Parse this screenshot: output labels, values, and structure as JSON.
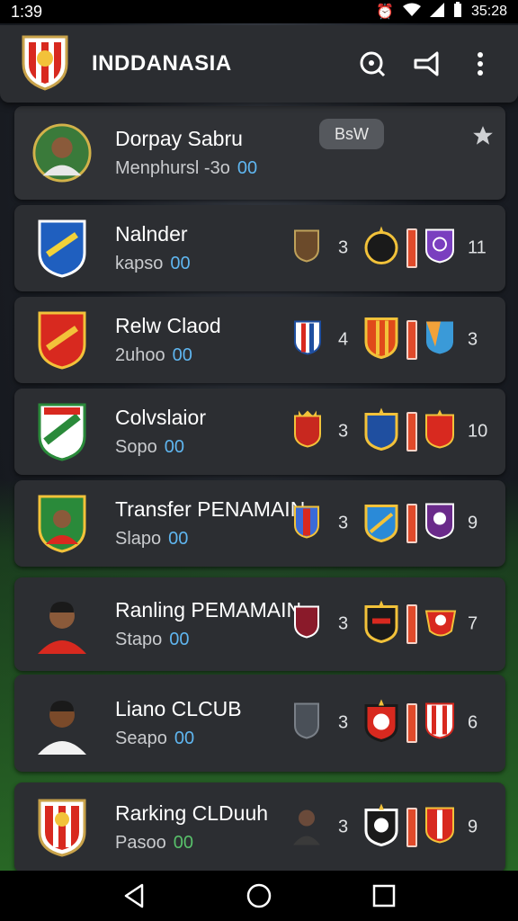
{
  "status_bar": {
    "time": "1:39",
    "clock_right": "35:28",
    "icons": [
      "alarm-icon",
      "wifi-icon",
      "signal-icon",
      "battery-icon"
    ]
  },
  "app_bar": {
    "title": "INDDANASIA",
    "actions": [
      "search-icon",
      "share-icon",
      "more-vert-icon"
    ]
  },
  "featured": {
    "name": "Dorpay Sabru",
    "subtitle": "Menphursl -3o",
    "number": "00",
    "badge_label": "BѕW"
  },
  "rows": [
    {
      "name": "Nalnder",
      "subtitle": "kapso",
      "number": "00",
      "left_value": "3",
      "right_value": "11"
    },
    {
      "name": "Relw Claod",
      "subtitle": "2uhoo",
      "number": "00",
      "left_value": "4",
      "right_value": "3"
    },
    {
      "name": "Colvslaior",
      "subtitle": "Sopo",
      "number": "00",
      "left_value": "3",
      "right_value": "10"
    },
    {
      "name": "Transfer PENAMAIN",
      "subtitle": "Slapo",
      "number": "00",
      "left_value": "3",
      "right_value": "9"
    },
    {
      "name": "Ranling PEMAMAIN",
      "subtitle": "Stapo",
      "number": "00",
      "left_value": "3",
      "right_value": "7"
    },
    {
      "name": "Liano CLCUB",
      "subtitle": "Seapo",
      "number": "00",
      "left_value": "3",
      "right_value": "6"
    },
    {
      "name": "Rarking CLDuuh",
      "subtitle": "Pasoo",
      "number": "00",
      "left_value": "3",
      "right_value": "9"
    }
  ],
  "colors": {
    "accent_blue": "#5fb6f0",
    "accent_green": "#58c06a",
    "bar_red": "#e04a2a",
    "card_bg": "#2c2e32"
  },
  "nav": [
    "back-icon",
    "home-icon",
    "recents-icon"
  ]
}
